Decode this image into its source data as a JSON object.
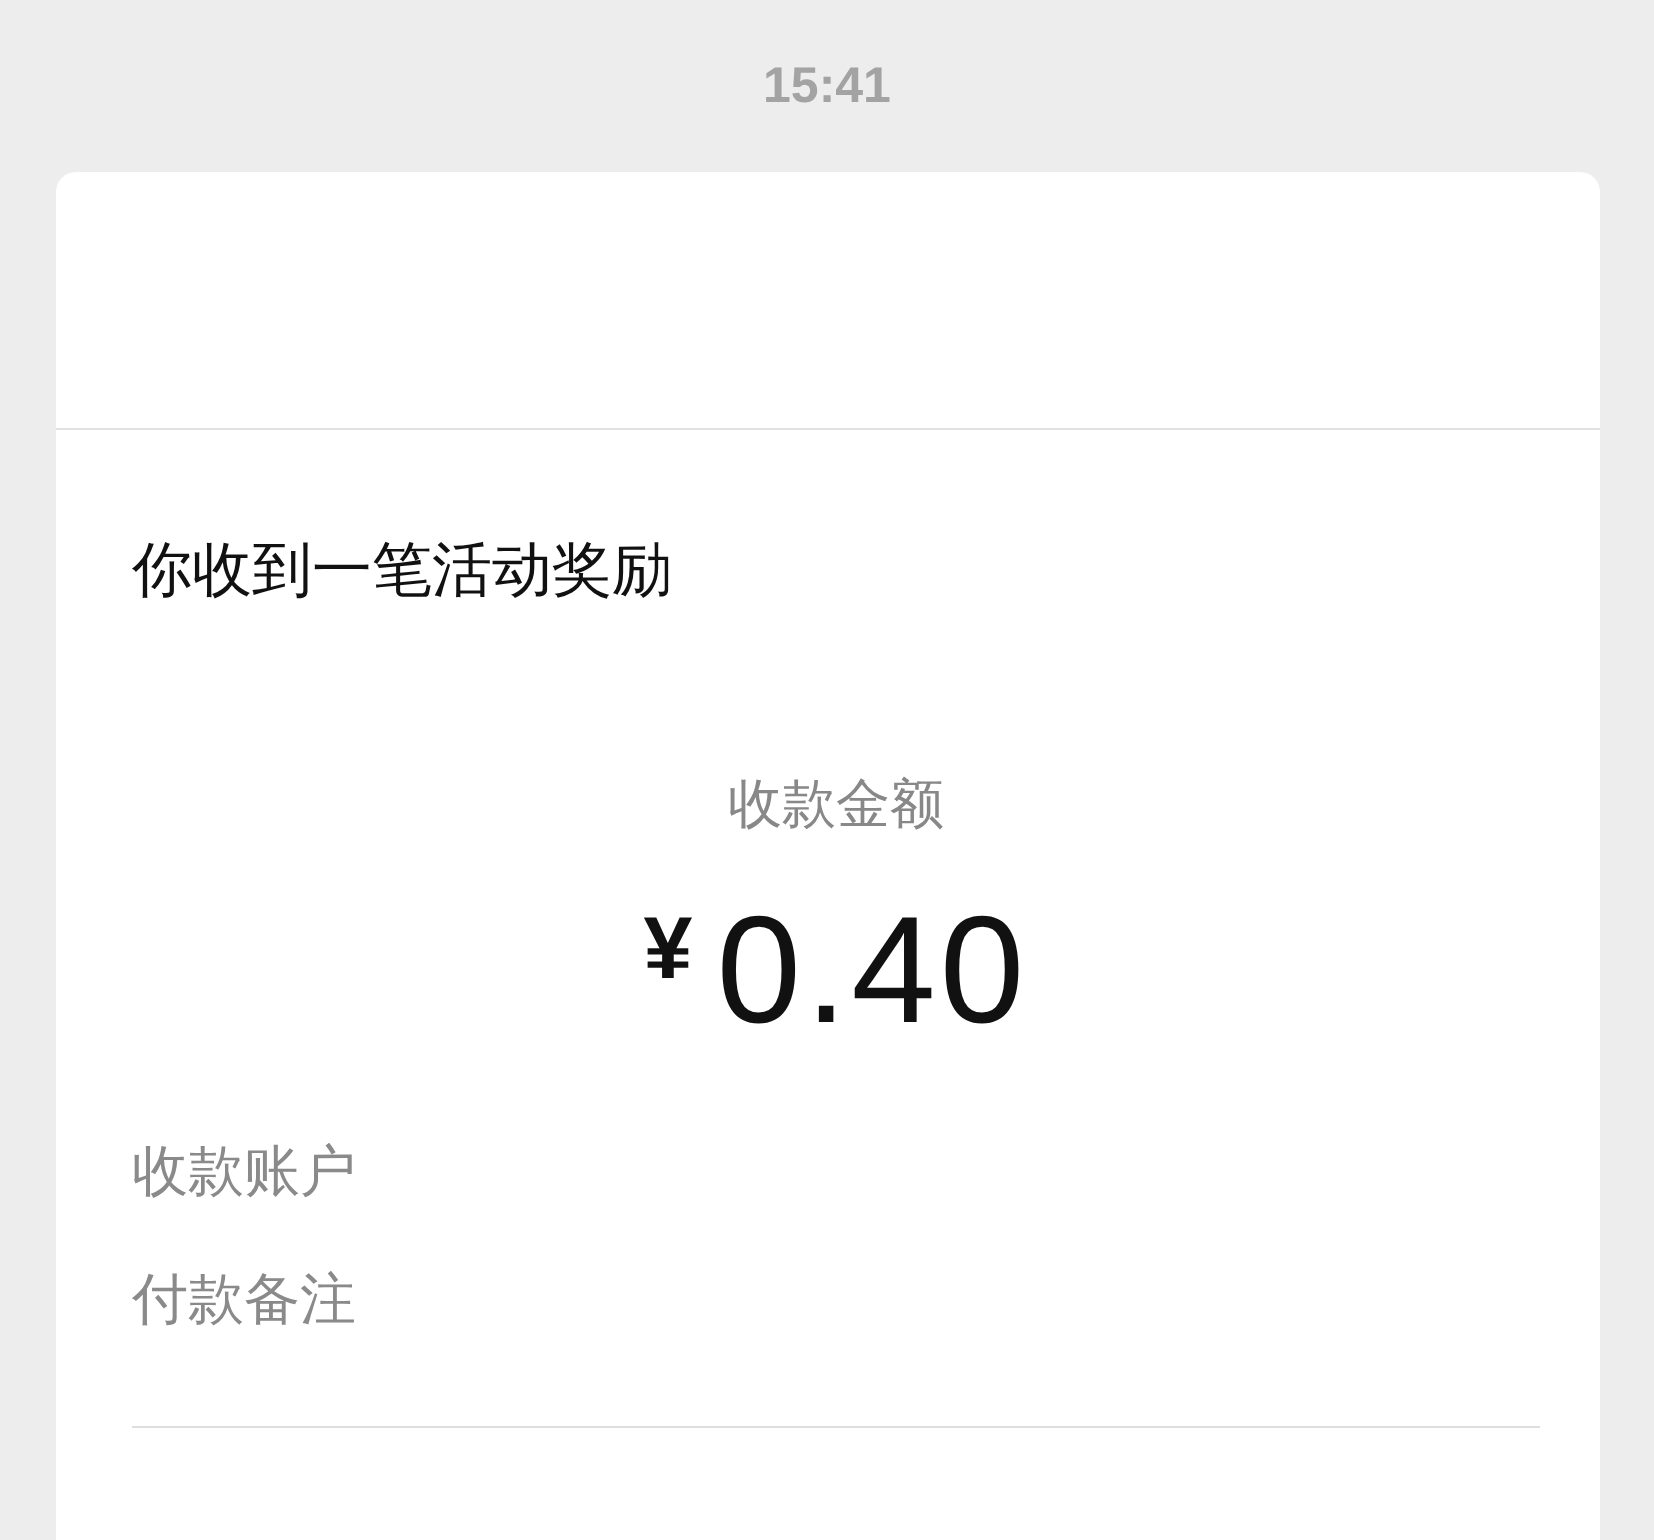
{
  "time": "15:41",
  "card": {
    "title": "你收到一笔活动奖励",
    "amount_label": "收款金额",
    "currency": "¥",
    "amount": "0.40",
    "rows": [
      {
        "label": "收款账户"
      },
      {
        "label": "付款备注"
      }
    ]
  }
}
